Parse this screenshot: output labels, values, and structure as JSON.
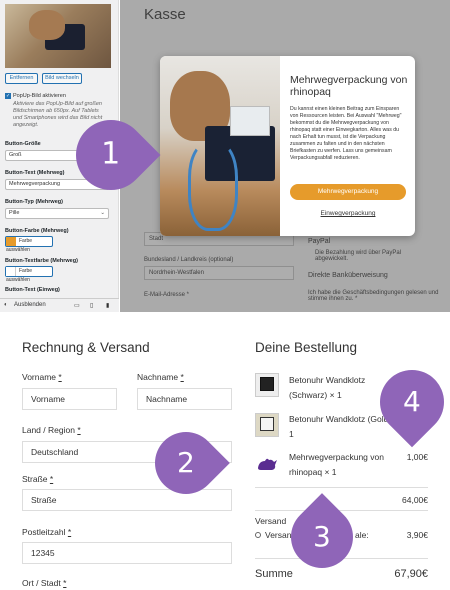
{
  "editor": {
    "remove_btn": "Entfernen",
    "change_btn": "Bild wechseln",
    "popup_check": "PopUp-Bild aktivieren",
    "popup_note": "Aktiviere das PopUp-Bild auf großen Bildschirmen ab 650px. Auf Tablets und Smartphones wird das Bild nicht angezeigt.",
    "size_label": "Button-Größe",
    "size_value": "Groß",
    "text_label": "Button-Text (Mehrweg)",
    "text_value": "Mehrwegverpackung",
    "type_label": "Button-Typ (Mehrweg)",
    "type_value": "Pille",
    "color_label": "Button-Farbe (Mehrweg)",
    "color_btn": "Farbe auswählen",
    "color_swatch": "#e69b2b",
    "textcolor_label": "Button-Textfarbe (Mehrweg)",
    "textcolor_btn": "Farbe auswählen",
    "textcolor_swatch": "#ffffff",
    "cut_label": "Button-Text (Einweg)",
    "hide_label": "Ausblenden"
  },
  "checkout": {
    "title": "Kasse",
    "bundesland_label": "Bundesland / Landkreis (optional)",
    "bundesland_value": "Nordrhein-Westfalen",
    "email_label": "E-Mail-Adresse *",
    "stadt_value": "Stadt",
    "paypal": "PayPal",
    "paypal_note": "Die Bezahlung wird über PayPal abgewickelt.",
    "bank": "Direkte Banküberweisung",
    "terms": "Ich habe die Geschäftsbedingungen gelesen und stimme ihnen zu. *"
  },
  "modal": {
    "title": "Mehrwegverpackung von rhinopaq",
    "body": "Du kannst einen kleinen Beitrag zum Einsparen von Ressourcen leisten. Bei Auswahl \"Mehrweg\" bekommst du die Mehrwegverpackung von rhinopaq statt einer Einwegkarton. Alles was du nach Erhalt tun musst, ist die Verpackung zusammen zu falten und in den nächsten Briefkasten zu werfen. Lass uns gemeinsam Verpackungsabfall reduzieren.",
    "primary_btn": "Mehrwegverpackung",
    "secondary_link": "Einwegverpackung",
    "accent": "#e69b2b"
  },
  "markers": [
    "1",
    "2",
    "3",
    "4"
  ],
  "marker_color": "#8f65b8",
  "billing": {
    "title": "Rechnung & Versand",
    "vorname_label": "Vorname",
    "vorname_value": "Vorname",
    "nachname_label": "Nachname",
    "nachname_value": "Nachname",
    "land_label": "Land / Region",
    "land_value": "Deutschland",
    "strasse_label": "Straße",
    "strasse_value": "Straße",
    "plz_label": "Postleitzahl",
    "plz_value": "12345",
    "ort_label": "Ort / Stadt",
    "req": "*"
  },
  "order": {
    "title": "Deine Bestellung",
    "items": [
      {
        "name": "Betonuhr Wandklotz (Schwarz) × 1"
      },
      {
        "name": "Betonuhr Wandklotz (Gold) × 1"
      },
      {
        "name": "Mehrwegverpackung von rhinopaq × 1",
        "price": "1,00€"
      }
    ],
    "subtotal": "64,00€",
    "shipping_label": "Versand",
    "shipping_option_a": "Versan",
    "shipping_option_b": "ale:",
    "shipping_price": "3,90€",
    "total_label": "Summe",
    "total": "67,90€"
  }
}
